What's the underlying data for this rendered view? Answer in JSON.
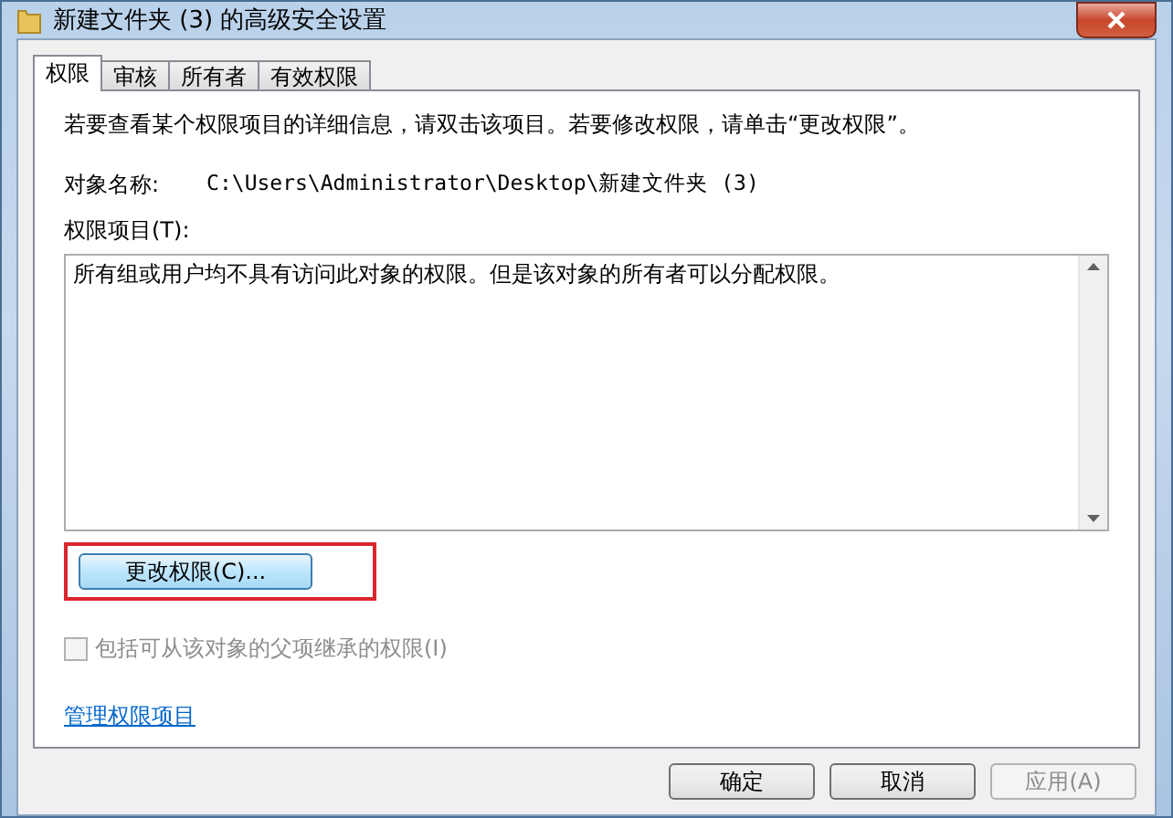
{
  "window": {
    "title": "新建文件夹 (3) 的高级安全设置"
  },
  "tabs": [
    {
      "label": "权限",
      "selected": true
    },
    {
      "label": "审核",
      "selected": false
    },
    {
      "label": "所有者",
      "selected": false
    },
    {
      "label": "有效权限",
      "selected": false
    }
  ],
  "instruction": "若要查看某个权限项目的详细信息，请双击该项目。若要修改权限，请单击“更改权限”。",
  "object_name": {
    "label": "对象名称:",
    "value": "C:\\Users\\Administrator\\Desktop\\新建文件夹 (3)"
  },
  "entries": {
    "label": "权限项目(T):",
    "message": "所有组或用户均不具有访问此对象的权限。但是该对象的所有者可以分配权限。"
  },
  "change_button": {
    "label": "更改权限(C)...",
    "highlighted": true
  },
  "inherit_checkbox": {
    "label": "包括可从该对象的父项继承的权限(I)",
    "checked": false,
    "disabled": true
  },
  "manage_link": "管理权限项目",
  "buttons": [
    {
      "label": "确定",
      "disabled": false
    },
    {
      "label": "取消",
      "disabled": false
    },
    {
      "label": "应用(A)",
      "disabled": true
    }
  ]
}
